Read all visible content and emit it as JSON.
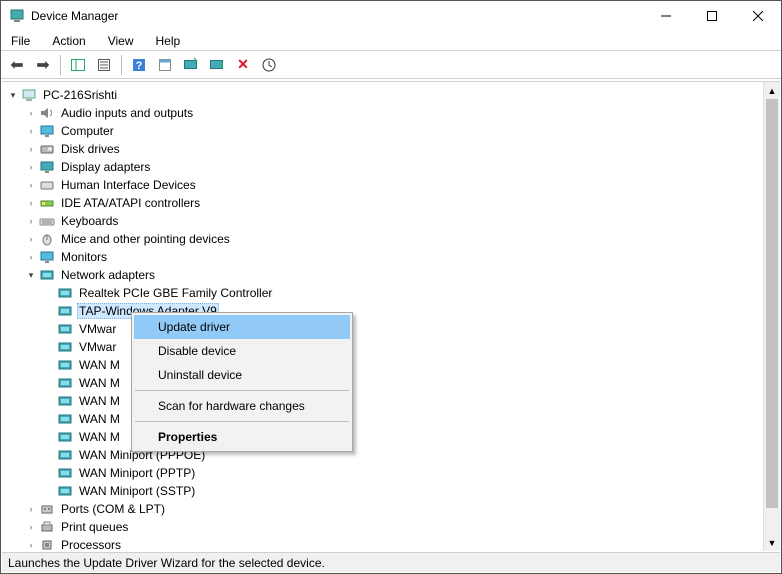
{
  "title_bar": {
    "title": "Device Manager"
  },
  "menu": {
    "file": "File",
    "action": "Action",
    "view": "View",
    "help": "Help"
  },
  "tree": {
    "root": "PC-216Srishti",
    "audio": "Audio inputs and outputs",
    "computer": "Computer",
    "disk": "Disk drives",
    "display": "Display adapters",
    "hid": "Human Interface Devices",
    "ide": "IDE ATA/ATAPI controllers",
    "keyboards": "Keyboards",
    "mice": "Mice and other pointing devices",
    "monitors": "Monitors",
    "network": "Network adapters",
    "net_items": {
      "realtek": "Realtek PCIe GBE Family Controller",
      "tap": "TAP-Windows Adapter V9",
      "vm1": "VMwar",
      "vm2": "VMwar",
      "wan1": "WAN M",
      "wan2": "WAN M",
      "wan3": "WAN M",
      "wan4": "WAN M",
      "wan5": "WAN M",
      "wan6": "WAN Miniport (PPPOE)",
      "wan7": "WAN Miniport (PPTP)",
      "wan8": "WAN Miniport (SSTP)"
    },
    "ports": "Ports (COM & LPT)",
    "printq": "Print queues",
    "proc": "Processors"
  },
  "context_menu": {
    "update": "Update driver",
    "disable": "Disable device",
    "uninstall": "Uninstall device",
    "scan": "Scan for hardware changes",
    "properties": "Properties"
  },
  "status": "Launches the Update Driver Wizard for the selected device."
}
